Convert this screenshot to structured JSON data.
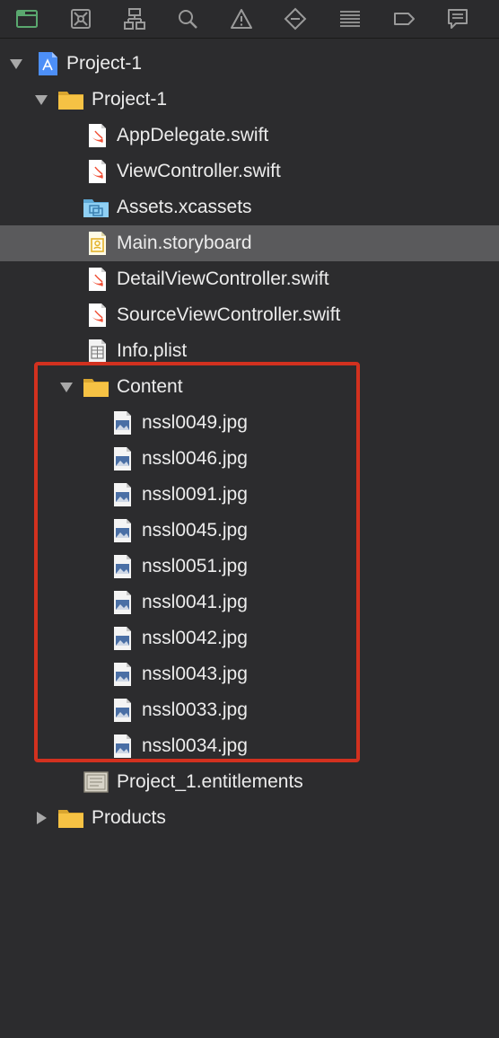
{
  "toolbar": {
    "buttons": [
      {
        "name": "project-navigator-icon",
        "active": true
      },
      {
        "name": "source-control-icon"
      },
      {
        "name": "symbol-navigator-icon"
      },
      {
        "name": "find-navigator-icon"
      },
      {
        "name": "issue-navigator-icon"
      },
      {
        "name": "test-navigator-icon"
      },
      {
        "name": "debug-navigator-icon"
      },
      {
        "name": "breakpoint-navigator-icon"
      },
      {
        "name": "report-navigator-icon"
      }
    ],
    "active_color": "#5aa86f"
  },
  "tree": {
    "root": {
      "label": "Project-1"
    },
    "group": {
      "label": "Project-1"
    },
    "files": {
      "app_delegate": "AppDelegate.swift",
      "view_controller": "ViewController.swift",
      "assets": "Assets.xcassets",
      "main_storyboard": "Main.storyboard",
      "detail_vc": "DetailViewController.swift",
      "source_vc": "SourceViewController.swift",
      "info_plist": "Info.plist"
    },
    "content_group": {
      "label": "Content"
    },
    "images": [
      "nssl0049.jpg",
      "nssl0046.jpg",
      "nssl0091.jpg",
      "nssl0045.jpg",
      "nssl0051.jpg",
      "nssl0041.jpg",
      "nssl0042.jpg",
      "nssl0043.jpg",
      "nssl0033.jpg",
      "nssl0034.jpg"
    ],
    "entitlements": "Project_1.entitlements",
    "products": {
      "label": "Products"
    },
    "selected": "Main.storyboard"
  },
  "colors": {
    "highlight_border": "#d2311f",
    "selected_row": "#5a5a5c",
    "folder": "#f6c244",
    "swift": "#f05138"
  }
}
